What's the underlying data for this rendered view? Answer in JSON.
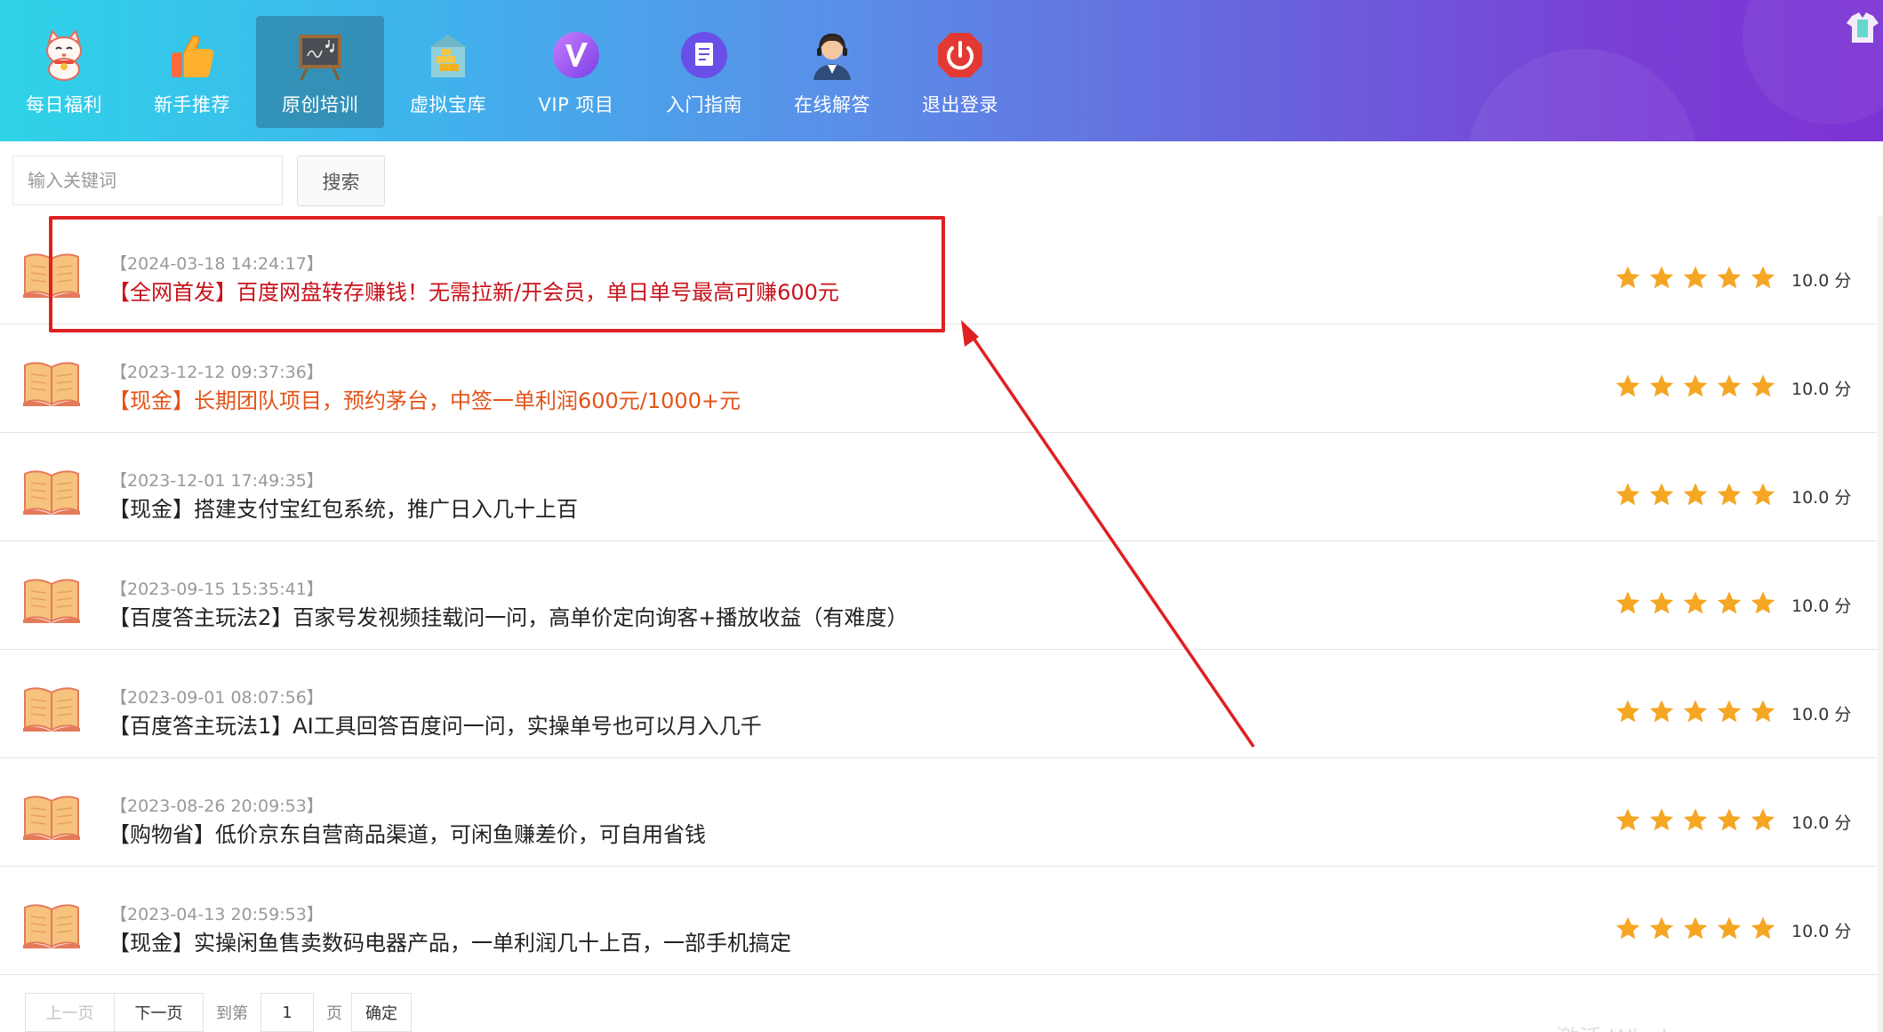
{
  "nav": {
    "items": [
      {
        "label": "每日福利",
        "icon": "lucky-cat-icon"
      },
      {
        "label": "新手推荐",
        "icon": "thumbs-up-icon"
      },
      {
        "label": "原创培训",
        "icon": "chalkboard-icon"
      },
      {
        "label": "虚拟宝库",
        "icon": "treasure-vault-icon"
      },
      {
        "label": "VIP 项目",
        "icon": "vip-badge-icon"
      },
      {
        "label": "入门指南",
        "icon": "document-icon"
      },
      {
        "label": "在线解答",
        "icon": "support-agent-icon"
      },
      {
        "label": "退出登录",
        "icon": "power-icon"
      }
    ],
    "active_index": 2
  },
  "search": {
    "placeholder": "输入关键词",
    "value": "",
    "button_label": "搜索"
  },
  "articles": [
    {
      "date": "【2024-03-18 14:24:17】",
      "title": "【全网首发】百度网盘转存赚钱！无需拉新/开会员，单日单号最高可赚600元",
      "title_color": "#c7121b",
      "rating": 5,
      "score": "10.0 分"
    },
    {
      "date": "【2023-12-12 09:37:36】",
      "title": "【现金】长期团队项目，预约茅台，中签一单利润600元/1000+元",
      "title_color": "#e2541a",
      "rating": 5,
      "score": "10.0 分"
    },
    {
      "date": "【2023-12-01 17:49:35】",
      "title": "【现金】搭建支付宝红包系统，推广日入几十上百",
      "title_color": "#222222",
      "rating": 5,
      "score": "10.0 分"
    },
    {
      "date": "【2023-09-15 15:35:41】",
      "title": "【百度答主玩法2】百家号发视频挂载问一问，高单价定向询客+播放收益（有难度）",
      "title_color": "#222222",
      "rating": 5,
      "score": "10.0 分"
    },
    {
      "date": "【2023-09-01 08:07:56】",
      "title": "【百度答主玩法1】AI工具回答百度问一问，实操单号也可以月入几千",
      "title_color": "#222222",
      "rating": 5,
      "score": "10.0 分"
    },
    {
      "date": "【2023-08-26 20:09:53】",
      "title": "【购物省】低价京东自营商品渠道，可闲鱼赚差价，可自用省钱",
      "title_color": "#222222",
      "rating": 5,
      "score": "10.0 分"
    },
    {
      "date": "【2023-04-13 20:59:53】",
      "title": "【现金】实操闲鱼售卖数码电器产品，一单利润几十上百，一部手机搞定",
      "title_color": "#222222",
      "rating": 5,
      "score": "10.0 分"
    }
  ],
  "pagination": {
    "prev_label": "上一页",
    "next_label": "下一页",
    "goto_prefix": "到第",
    "page_value": "1",
    "goto_suffix": "页",
    "confirm_label": "确定"
  },
  "watermark": "激活 Wind",
  "colors": {
    "star": "#f5a623",
    "annotation": "#e02020",
    "header_start": "#2fd3e8",
    "header_end": "#7c33d3"
  }
}
